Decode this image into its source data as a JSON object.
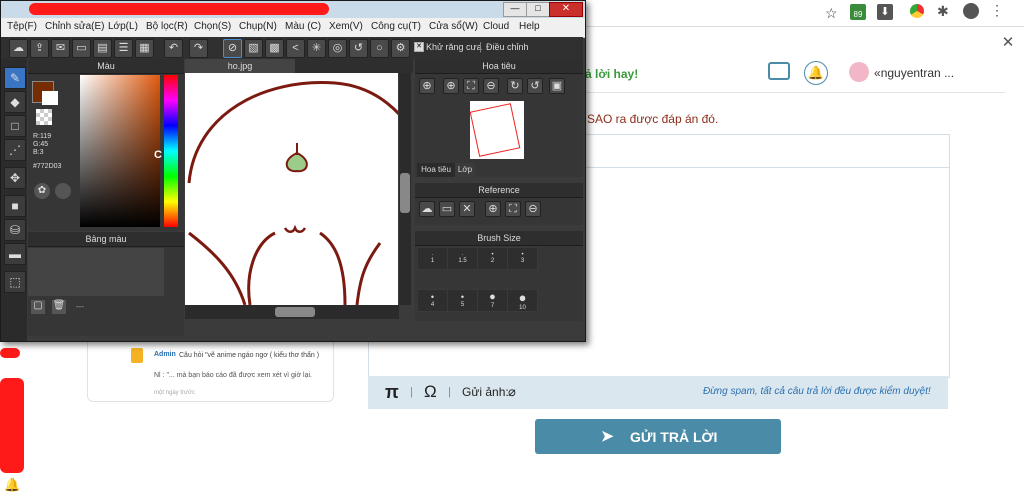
{
  "browser": {
    "toolbar_icons": [
      "star-icon",
      "extension-badge-icon",
      "download-icon",
      "chrome-icon",
      "puzzle-icon",
      "account-icon",
      "more-icon"
    ],
    "badge_count": "89"
  },
  "site": {
    "header_text": "ả lời hay!",
    "username": "nguyentran ...",
    "question_line": "SAO ra được đáp án đó.",
    "spam_notice": "Đừng spam, tất cả câu trả lời đều được kiểm duyệt!",
    "attach_label": "Gửi ảnh:",
    "pi_symbol": "π",
    "omega_symbol": "Ω",
    "send_button": "GỬI TRẢ LỜI",
    "admin_name": "Admin",
    "admin_text1": "Câu hỏi \"vẽ anime ngáo ngơ ( kiểu thơ thẩn )",
    "admin_text2": "Nl : \"... mà bạn báo cáo đã được xem xét vì giờ lại.",
    "admin_time": "một ngày trước",
    "accent": "#4a8ba8"
  },
  "app": {
    "menu": [
      "Tệp(F)",
      "Chỉnh sửa(E)",
      "Lớp(L)",
      "Bộ lọc(R)",
      "Chọn(S)",
      "Chụp(N)",
      "Màu (C)",
      "Xem(V)",
      "Công cụ(T)",
      "Cửa sổ(W)",
      "Cloud",
      "Help"
    ],
    "antialias_label": "Khử răng cưa",
    "adjust_label": "Điều chỉnh",
    "color_panel_title": "Màu",
    "rgb_r": "R:119",
    "rgb_g": "G:45",
    "rgb_b": "B:3",
    "hex": "#772D03",
    "palette_title": "Bảng màu",
    "canvas_tab": "ho.jpg",
    "navigator_title": "Hoa tiêu",
    "tab_navigator": "Hoa tiêu",
    "tab_layer": "Lớp",
    "reference_title": "Reference",
    "brush_title": "Brush Size",
    "brush_sizes": [
      "1",
      "1.5",
      "2",
      "3",
      "4",
      "5",
      "7",
      "10"
    ],
    "current_color": "#772d03",
    "palette_dash": "---"
  }
}
